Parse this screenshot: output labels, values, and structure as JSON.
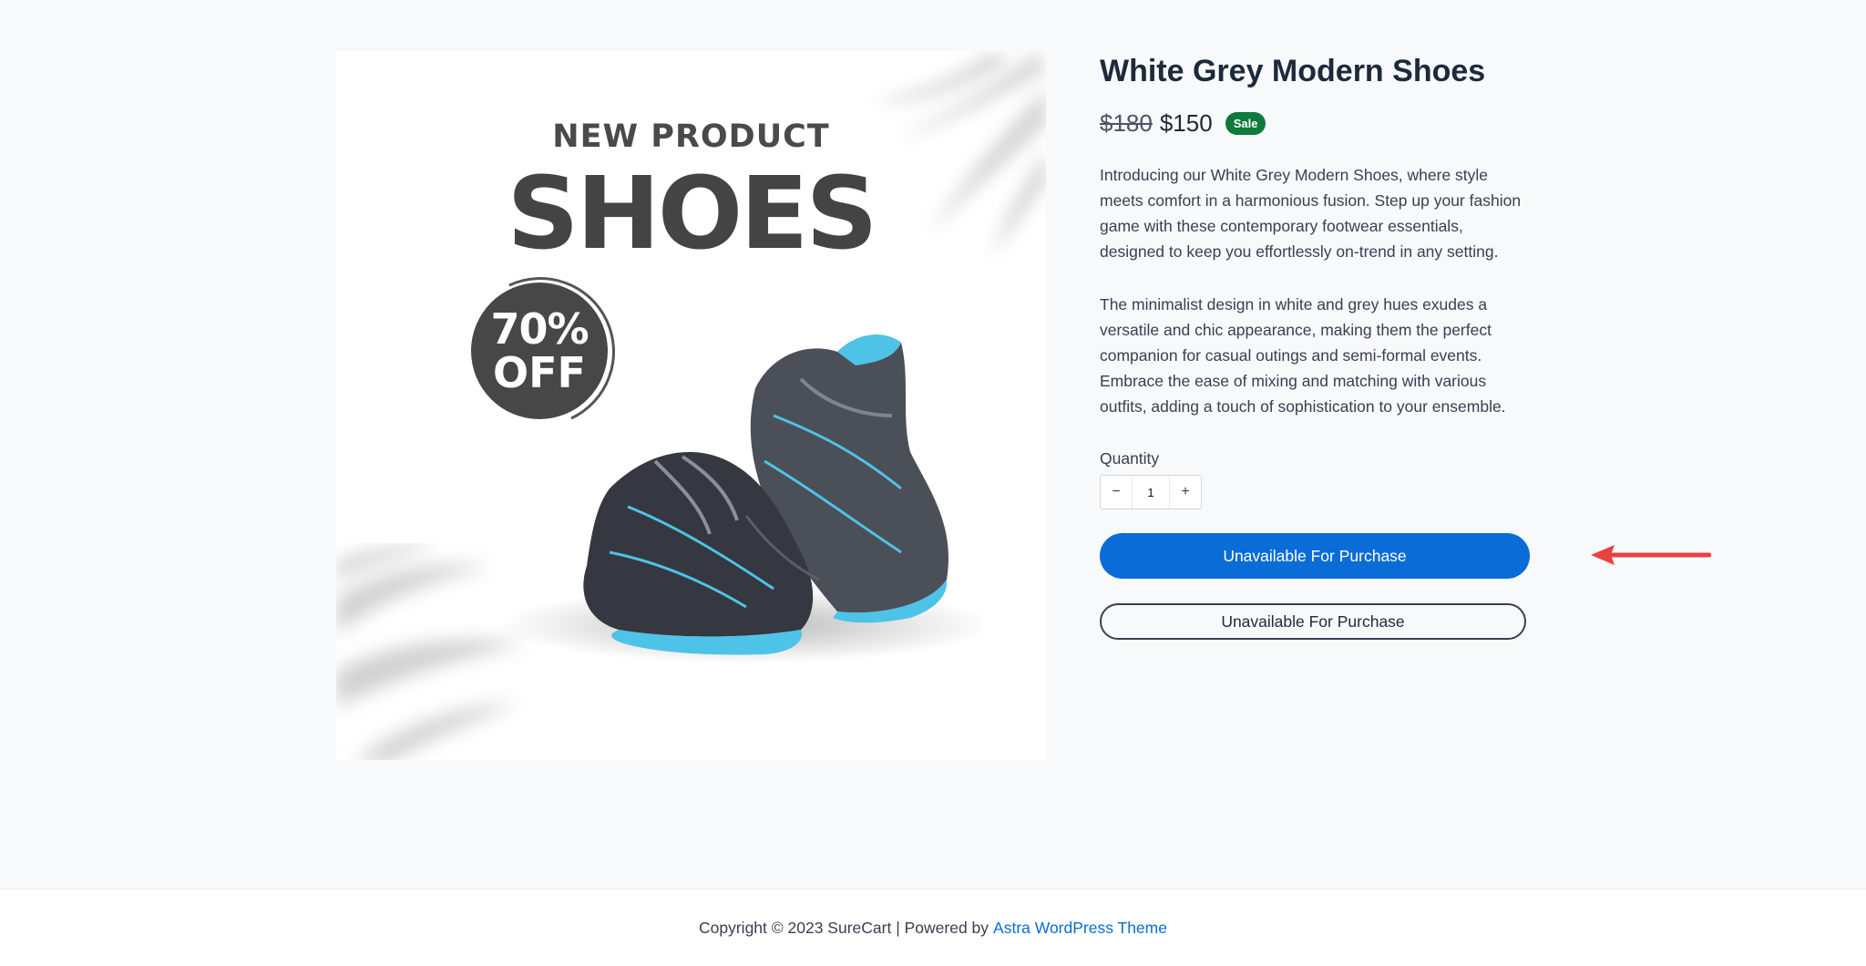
{
  "product": {
    "title": "White Grey Modern Shoes",
    "original_price": "$180",
    "sale_price": "$150",
    "sale_badge": "Sale",
    "description_1": "Introducing our White Grey Modern Shoes, where style meets comfort in a harmonious fusion. Step up your fashion game with these contemporary footwear essentials, designed to keep you effortlessly on-trend in any setting.",
    "description_2": "The minimalist design in white and grey hues exudes a versatile and chic appearance, making them the perfect companion for casual outings and semi-formal events. Embrace the ease of mixing and matching with various outfits, adding a touch of sophistication to your ensemble."
  },
  "image": {
    "promo_line1": "NEW PRODUCT",
    "promo_line2": "SHOES",
    "discount_value": "70%",
    "discount_word": "OFF"
  },
  "quantity": {
    "label": "Quantity",
    "value": "1",
    "decrement": "−",
    "increment": "+"
  },
  "buttons": {
    "primary_label": "Unavailable For Purchase",
    "secondary_label": "Unavailable For Purchase"
  },
  "footer": {
    "copyright": "Copyright © 2023 SureCart | Powered by",
    "link_text": "Astra WordPress Theme"
  },
  "colors": {
    "accent": "#0a6cd6",
    "sale_badge": "#0f7a3a",
    "annotation_arrow": "#e84141",
    "shoe_accent": "#4ec3e8"
  },
  "icons": [
    "minus-icon",
    "plus-icon",
    "annotation-arrow-icon"
  ]
}
